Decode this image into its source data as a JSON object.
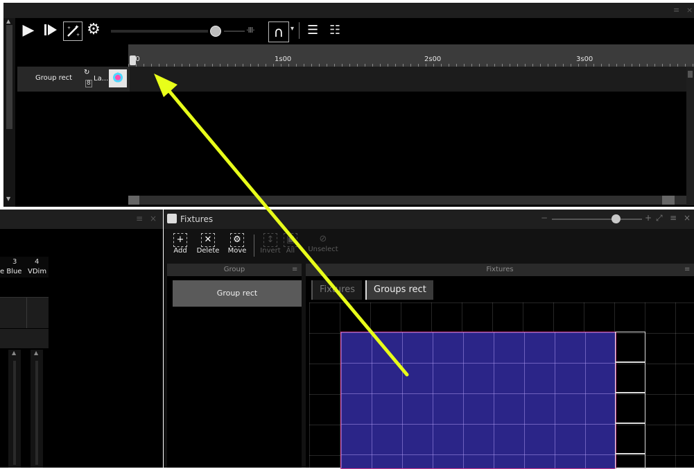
{
  "timeline": {
    "ruler_ticks": [
      "00",
      "1s00",
      "2s00",
      "3s00"
    ],
    "track": {
      "group": "Group rect",
      "layer": "La...",
      "count": "8"
    }
  },
  "lower_left": {
    "columns": [
      {
        "num": "3",
        "label": "e Blue"
      },
      {
        "num": "4",
        "label": "VDim"
      }
    ]
  },
  "fixtures": {
    "title": "Fixtures",
    "toolbar": [
      {
        "label": "Add",
        "glyph": "+"
      },
      {
        "label": "Delete",
        "glyph": "✕"
      },
      {
        "label": "Move",
        "glyph": "⚙"
      },
      {
        "label": "Invert",
        "glyph": "↕"
      },
      {
        "label": "All",
        "glyph": "▣"
      },
      {
        "label": "Unselect",
        "glyph": "⊘"
      }
    ],
    "group_column_header": "Group",
    "group_item": "Group rect",
    "fixtures_column_header": "Fixtures",
    "tabs": [
      "Fixtures",
      "Groups rect"
    ]
  },
  "colors": {
    "accent_arrow": "#e8ff1a",
    "grid_fill": "#2b2588",
    "group_selected_border": "#c93b8d"
  },
  "icons": [
    "play-icon",
    "play-step-icon",
    "magic-wand-icon",
    "gear-icon",
    "magnet-icon",
    "align-icon",
    "fixtures-icon",
    "menu-icon",
    "close-icon"
  ]
}
